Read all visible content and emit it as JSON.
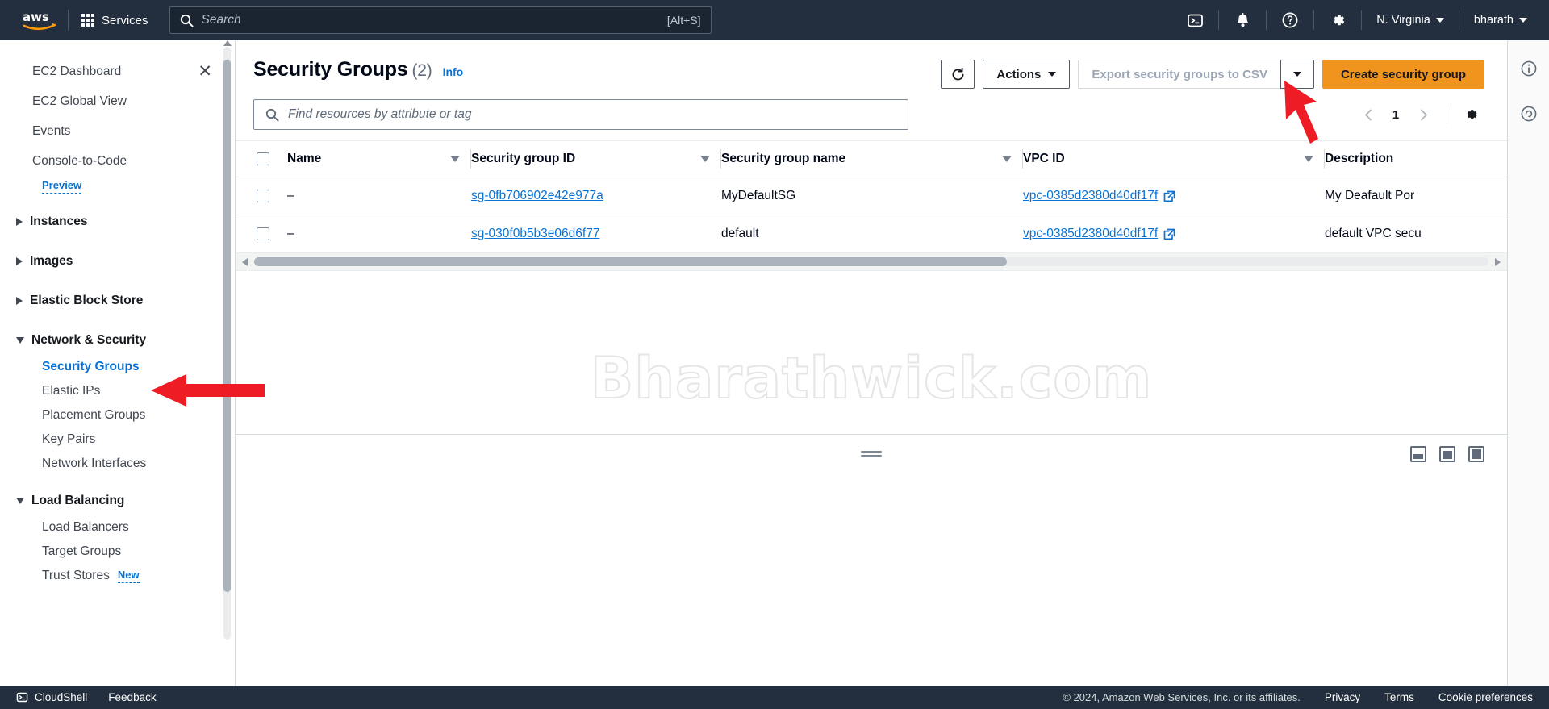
{
  "topnav": {
    "logo": "aws",
    "services_label": "Services",
    "search_placeholder": "Search",
    "search_hint": "[Alt+S]",
    "cloudshell_icon": "cloudshell-terminal-icon",
    "notifications_icon": "bell-icon",
    "help_icon": "question-circle-icon",
    "settings_icon": "gear-icon",
    "region_label": "N. Virginia",
    "account_label": "bharath"
  },
  "sidebar": {
    "close_icon": "close-icon",
    "items": [
      {
        "label": "EC2 Dashboard",
        "type": "link",
        "closable": true
      },
      {
        "label": "EC2 Global View",
        "type": "link"
      },
      {
        "label": "Events",
        "type": "link"
      },
      {
        "label": "Console-to-Code",
        "type": "link",
        "badge": "Preview"
      },
      {
        "label": "Instances",
        "type": "group",
        "expanded": false
      },
      {
        "label": "Images",
        "type": "group",
        "expanded": false
      },
      {
        "label": "Elastic Block Store",
        "type": "group",
        "expanded": false
      },
      {
        "label": "Network & Security",
        "type": "group",
        "expanded": true
      },
      {
        "label": "Security Groups",
        "type": "sub",
        "active": true
      },
      {
        "label": "Elastic IPs",
        "type": "sub"
      },
      {
        "label": "Placement Groups",
        "type": "sub"
      },
      {
        "label": "Key Pairs",
        "type": "sub"
      },
      {
        "label": "Network Interfaces",
        "type": "sub"
      },
      {
        "label": "Load Balancing",
        "type": "group",
        "expanded": true
      },
      {
        "label": "Load Balancers",
        "type": "sub"
      },
      {
        "label": "Target Groups",
        "type": "sub"
      },
      {
        "label": "Trust Stores",
        "type": "sub",
        "badge": "New"
      }
    ]
  },
  "page": {
    "title": "Security Groups",
    "count": "(2)",
    "info_label": "Info",
    "watermark": "Bharathwick.com"
  },
  "toolbar": {
    "refresh_icon": "refresh-icon",
    "actions_label": "Actions",
    "export_label": "Export security groups to CSV",
    "export_disabled": true,
    "export_dropdown_icon": "chevron-down-icon",
    "create_label": "Create security group"
  },
  "filter": {
    "search_placeholder": "Find resources by attribute or tag",
    "search_icon": "search-icon",
    "prev_icon": "chevron-left-icon",
    "next_icon": "chevron-right-icon",
    "page_number": "1",
    "preferences_icon": "gear-icon"
  },
  "table": {
    "columns": [
      {
        "label": "Name",
        "sortable": true
      },
      {
        "label": "Security group ID",
        "sortable": true
      },
      {
        "label": "Security group name",
        "sortable": true
      },
      {
        "label": "VPC ID",
        "sortable": true
      },
      {
        "label": "Description",
        "sortable": false
      }
    ],
    "rows": [
      {
        "name": "–",
        "sg_id": "sg-0fb706902e42e977a",
        "sg_name": "MyDefaultSG",
        "vpc_id": "vpc-0385d2380d40df17f",
        "description": "My Deafault Por"
      },
      {
        "name": "–",
        "sg_id": "sg-030f0b5b3e06d6f77",
        "sg_name": "default",
        "vpc_id": "vpc-0385d2380d40df17f",
        "description": "default VPC secu"
      }
    ]
  },
  "split_panel": {
    "drag_handle": "drag-handle",
    "position_bottom_icon": "panel-bottom-icon",
    "position_half_icon": "panel-half-icon",
    "position_full_icon": "panel-full-icon"
  },
  "right_rail": {
    "info_icon": "info-circle-icon",
    "shortcuts_icon": "shortcuts-icon"
  },
  "footer": {
    "cloudshell_label": "CloudShell",
    "cloudshell_icon": "cloudshell-terminal-icon",
    "feedback_label": "Feedback",
    "copyright": "© 2024, Amazon Web Services, Inc. or its affiliates.",
    "privacy_label": "Privacy",
    "terms_label": "Terms",
    "cookie_label": "Cookie preferences"
  },
  "annotations": {
    "accent_color": "#ee1c25",
    "arrow_to_create_button": "arrow-pointing-to-create-security-group",
    "arrow_to_security_groups": "arrow-pointing-to-security-groups-nav"
  }
}
